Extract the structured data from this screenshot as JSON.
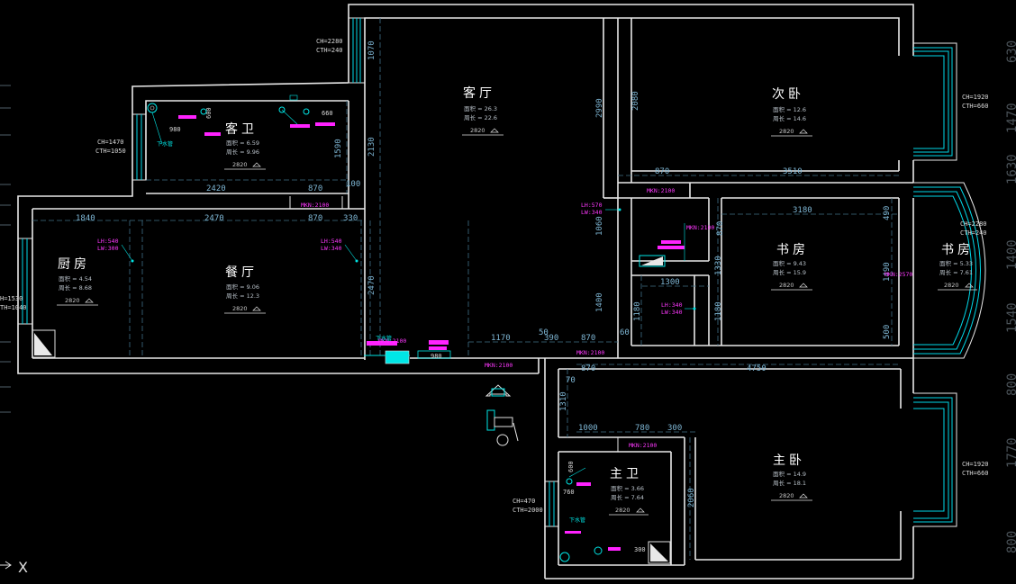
{
  "rooms": [
    {
      "name": "客厅",
      "area": "面积 = 26.3",
      "perimeter": "周长 = 22.6",
      "height": "2820"
    },
    {
      "name": "次卧",
      "area": "面积 = 12.6",
      "perimeter": "周长 = 14.6",
      "height": "2820"
    },
    {
      "name": "客卫",
      "area": "面积 = 6.59",
      "perimeter": "周长 = 9.96",
      "height": "2820"
    },
    {
      "name": "厨房",
      "area": "面积 = 4.54",
      "perimeter": "周长 = 8.68",
      "height": "2820"
    },
    {
      "name": "餐厅",
      "area": "面积 = 9.06",
      "perimeter": "周长 = 12.3",
      "height": "2820"
    },
    {
      "name": "书房",
      "area": "面积 = 9.43",
      "perimeter": "周长 = 15.9",
      "height": "2820"
    },
    {
      "name": "书房",
      "area": "面积 = 5.33",
      "perimeter": "周长 = 7.61",
      "height": "2820"
    },
    {
      "name": "主卧",
      "area": "面积 = 14.9",
      "perimeter": "周长 = 18.1",
      "height": "2820"
    },
    {
      "name": "主卫",
      "area": "面积 = 3.66",
      "perimeter": "周长 = 7.64",
      "height": "2820"
    }
  ],
  "dimensions": [
    "1070",
    "2130",
    "2990",
    "2080",
    "1590",
    "2420",
    "870",
    "100",
    "870",
    "3510",
    "1840",
    "2470",
    "870",
    "330",
    "3180",
    "490",
    "870",
    "1060",
    "1330",
    "1300",
    "1490",
    "500",
    "1180",
    "1400",
    "1180",
    "2470",
    "1170",
    "50",
    "390",
    "870",
    "60",
    "870",
    "4750",
    "70",
    "1310",
    "1000",
    "780",
    "300",
    "600",
    "2060"
  ],
  "window_notes": [
    {
      "ch": "CH=2280",
      "cth": "CTH=240"
    },
    {
      "ch": "CH=1470",
      "cth": "CTH=1050"
    },
    {
      "ch": "CH=1920",
      "cth": "CTH=660"
    },
    {
      "ch": "CH=2280",
      "cth": "CTH=240"
    },
    {
      "ch": "H=1530",
      "cth": "TH=1040"
    },
    {
      "ch": "CH=470",
      "cth": "CTH=2000"
    },
    {
      "ch": "CH=1920",
      "cth": "CTH=660"
    }
  ],
  "door_tags": [
    "MKN:2100",
    "MKN:2100",
    "MKN:2100",
    "MKN:2100",
    "MKN:2100",
    "MKN:2100",
    "MKN:2100",
    "MKN:2570"
  ],
  "opening_tags": [
    {
      "lh": "LH:540",
      "lw": "LW:300"
    },
    {
      "lh": "LH:540",
      "lw": "LW:340"
    },
    {
      "lh": "LH:570",
      "lw": "LW:340"
    },
    {
      "lh": "LH:340",
      "lw": "LW:340"
    }
  ],
  "fixture_labels": [
    "980",
    "660",
    "下水管",
    "下水管",
    "600",
    "980",
    "760",
    "下水管",
    "300"
  ],
  "right_ruler": [
    "630",
    "1470",
    "1630",
    "1400",
    "1540",
    "800",
    "1770",
    "800"
  ],
  "axis_label": "X"
}
